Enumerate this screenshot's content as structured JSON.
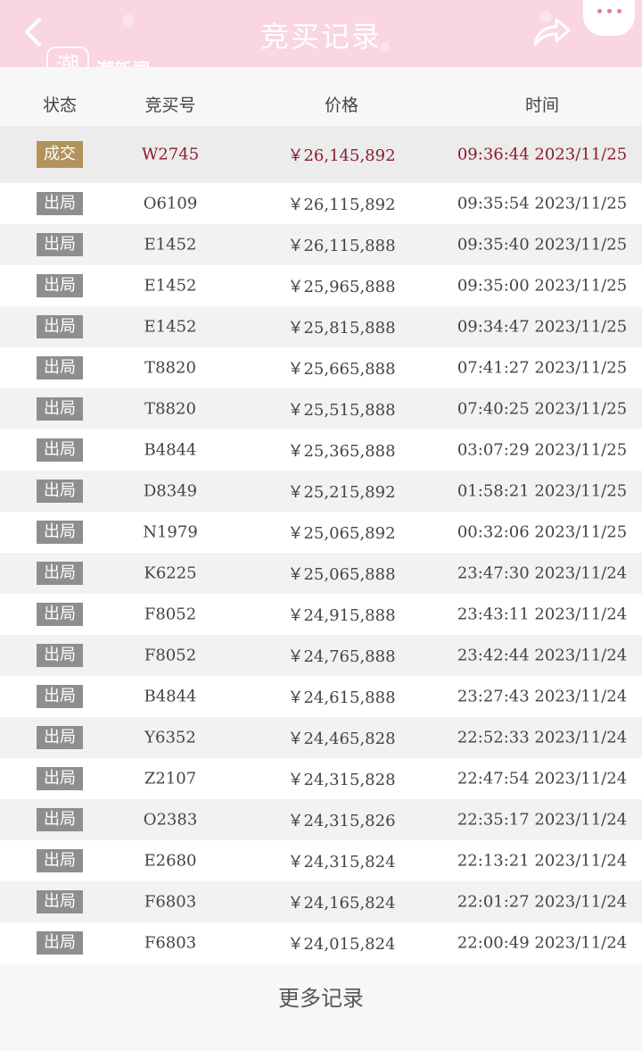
{
  "header": {
    "title": "竞买记录",
    "watermark": "潮新闻",
    "watermark_logo": "潮"
  },
  "columns": {
    "status": "状态",
    "bid_no": "竞买号",
    "price": "价格",
    "time": "时间"
  },
  "rows": [
    {
      "status": "成交",
      "bid_no": "W2745",
      "price": "￥26,145,892",
      "time": "09:36:44 2023/11/25"
    },
    {
      "status": "出局",
      "bid_no": "O6109",
      "price": "￥26,115,892",
      "time": "09:35:54 2023/11/25"
    },
    {
      "status": "出局",
      "bid_no": "E1452",
      "price": "￥26,115,888",
      "time": "09:35:40 2023/11/25"
    },
    {
      "status": "出局",
      "bid_no": "E1452",
      "price": "￥25,965,888",
      "time": "09:35:00 2023/11/25"
    },
    {
      "status": "出局",
      "bid_no": "E1452",
      "price": "￥25,815,888",
      "time": "09:34:47 2023/11/25"
    },
    {
      "status": "出局",
      "bid_no": "T8820",
      "price": "￥25,665,888",
      "time": "07:41:27 2023/11/25"
    },
    {
      "status": "出局",
      "bid_no": "T8820",
      "price": "￥25,515,888",
      "time": "07:40:25 2023/11/25"
    },
    {
      "status": "出局",
      "bid_no": "B4844",
      "price": "￥25,365,888",
      "time": "03:07:29 2023/11/25"
    },
    {
      "status": "出局",
      "bid_no": "D8349",
      "price": "￥25,215,892",
      "time": "01:58:21 2023/11/25"
    },
    {
      "status": "出局",
      "bid_no": "N1979",
      "price": "￥25,065,892",
      "time": "00:32:06 2023/11/25"
    },
    {
      "status": "出局",
      "bid_no": "K6225",
      "price": "￥25,065,888",
      "time": "23:47:30 2023/11/24"
    },
    {
      "status": "出局",
      "bid_no": "F8052",
      "price": "￥24,915,888",
      "time": "23:43:11 2023/11/24"
    },
    {
      "status": "出局",
      "bid_no": "F8052",
      "price": "￥24,765,888",
      "time": "23:42:44 2023/11/24"
    },
    {
      "status": "出局",
      "bid_no": "B4844",
      "price": "￥24,615,888",
      "time": "23:27:43 2023/11/24"
    },
    {
      "status": "出局",
      "bid_no": "Y6352",
      "price": "￥24,465,828",
      "time": "22:52:33 2023/11/24"
    },
    {
      "status": "出局",
      "bid_no": "Z2107",
      "price": "￥24,315,828",
      "time": "22:47:54 2023/11/24"
    },
    {
      "status": "出局",
      "bid_no": "O2383",
      "price": "￥24,315,826",
      "time": "22:35:17 2023/11/24"
    },
    {
      "status": "出局",
      "bid_no": "E2680",
      "price": "￥24,315,824",
      "time": "22:13:21 2023/11/24"
    },
    {
      "status": "出局",
      "bid_no": "F6803",
      "price": "￥24,165,824",
      "time": "22:01:27 2023/11/24"
    },
    {
      "status": "出局",
      "bid_no": "F6803",
      "price": "￥24,015,824",
      "time": "22:00:49 2023/11/24"
    }
  ],
  "footer": {
    "more_label": "更多记录"
  },
  "icons": {
    "back": "chevron-left-icon",
    "share": "share-arrow-icon",
    "more": "more-dots-icon"
  },
  "colors": {
    "topbar": "#f9d6e0",
    "winner_text": "#8a1c2c",
    "winner_badge": "#b3935b",
    "out_badge": "#8e8e8e"
  }
}
